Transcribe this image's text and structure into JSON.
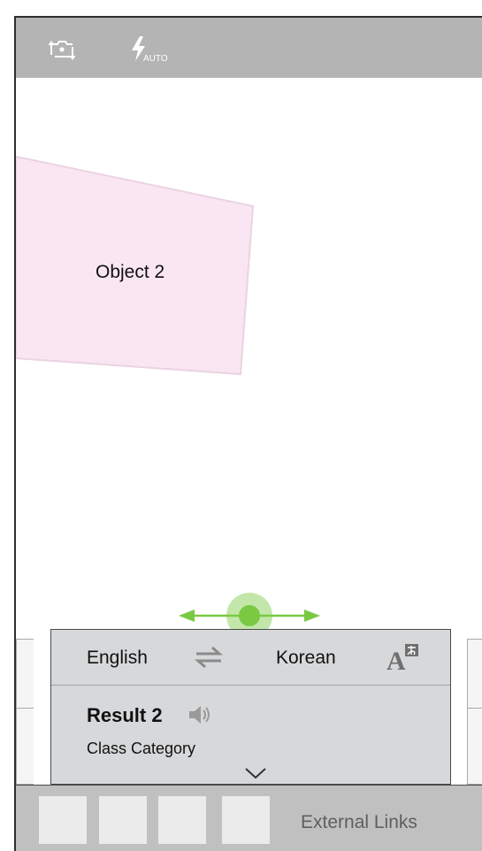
{
  "toolbar": {
    "camera_switch_icon": "camera-switch-icon",
    "flash_icon": "flash-auto-icon",
    "flash_mode": "AUTO",
    "bar_color": "#b4b4b4"
  },
  "viewfinder": {
    "object_label": "Object 2",
    "object_color": "#fae6f2"
  },
  "slider": {
    "accent_color": "#7ac943"
  },
  "translation_panel": {
    "source_language": "English",
    "target_language": "Korean",
    "swap_icon": "swap-arrows-icon",
    "translate_icon": "translate-icon",
    "result_title": "Result 2",
    "speaker_icon": "speaker-icon",
    "result_category": "Class Category",
    "expand_icon": "chevron-down-icon",
    "panel_color": "#d7d8da"
  },
  "bottom_bar": {
    "thumbnail_count": 4,
    "external_links_label": "External Links"
  }
}
